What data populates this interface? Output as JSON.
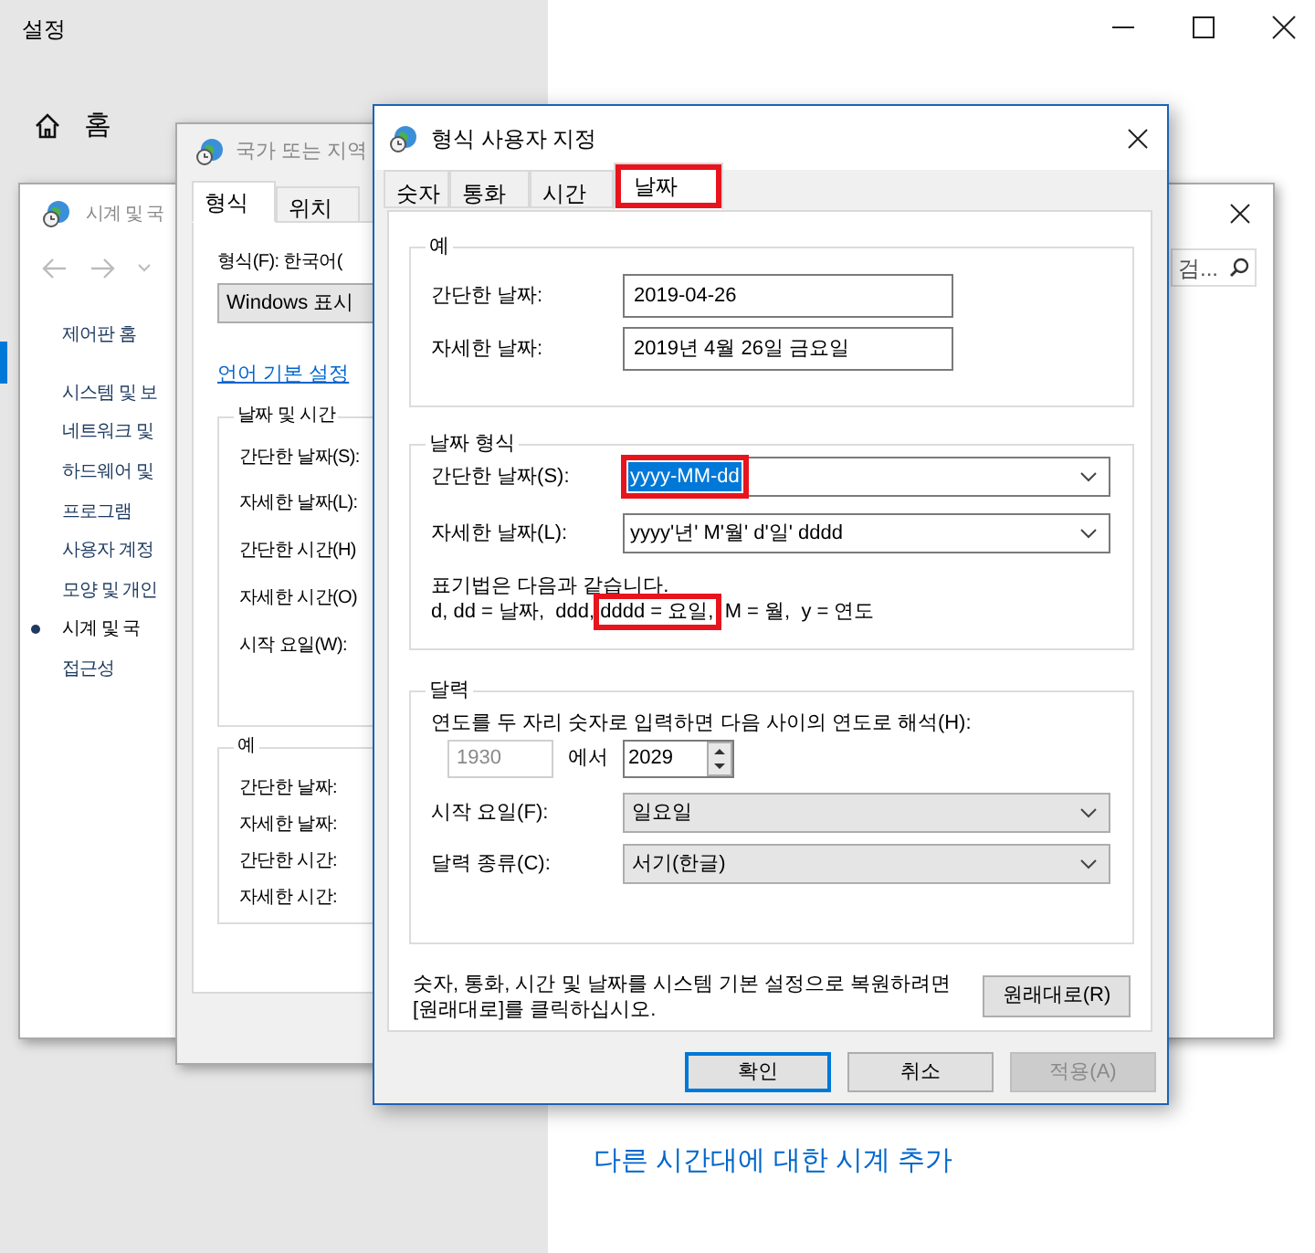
{
  "settings": {
    "title": "설정",
    "home": "홈",
    "link": "다른 시간대에 대한 시계 추가"
  },
  "control_panel": {
    "title": "시계 및 국",
    "search": {
      "placeholder": "검..."
    },
    "sidebar": [
      {
        "label": "제어판 홈",
        "selected": false
      },
      {
        "label": "시스템 및 보",
        "selected": false
      },
      {
        "label": "네트워크 및",
        "selected": false
      },
      {
        "label": "하드웨어 및",
        "selected": false
      },
      {
        "label": "프로그램",
        "selected": false
      },
      {
        "label": "사용자 계정",
        "selected": false
      },
      {
        "label": "모양 및 개인",
        "selected": false
      },
      {
        "label": "시계 및 국",
        "selected": true
      },
      {
        "label": "접근성",
        "selected": false
      }
    ]
  },
  "region_dialog": {
    "title": "국가 또는 지역",
    "tabs": [
      {
        "label": "형식",
        "selected": true
      },
      {
        "label": "위치",
        "selected": false
      }
    ],
    "format_label": "형식(F): 한국어(",
    "display_dropdown": "Windows 표시",
    "language_link": "언어 기본 설정",
    "formats_group": {
      "title": "날짜 및 시간",
      "labels": [
        "간단한 날짜(S):",
        "자세한 날짜(L):",
        "간단한 시간(H)",
        "자세한 시간(O)",
        "시작 요일(W):"
      ]
    },
    "examples_group": {
      "title": "예",
      "labels": [
        "간단한 날짜:",
        "자세한 날짜:",
        "간단한 시간:",
        "자세한 시간:"
      ]
    }
  },
  "custom_dialog": {
    "title": "형식 사용자 지정",
    "tabs": [
      {
        "label": "숫자",
        "selected": false,
        "highlighted": false
      },
      {
        "label": "통화",
        "selected": false,
        "highlighted": false
      },
      {
        "label": "시간",
        "selected": false,
        "highlighted": false
      },
      {
        "label": "날짜",
        "selected": true,
        "highlighted": true
      }
    ],
    "example_group": {
      "title": "예",
      "rows": [
        {
          "label": "간단한 날짜:",
          "value": "2019-04-26"
        },
        {
          "label": "자세한 날짜:",
          "value": "2019년 4월 26일 금요일"
        }
      ]
    },
    "date_format_group": {
      "title": "날짜 형식",
      "rows": [
        {
          "label": "간단한 날짜(S):",
          "value": "yyyy-MM-dd",
          "text_selected": true,
          "highlighted": true
        },
        {
          "label": "자세한 날짜(L):",
          "value": "yyyy'년' M'월' d'일' dddd",
          "text_selected": false,
          "highlighted": false
        }
      ],
      "notation_title": "표기법은 다음과 같습니다.",
      "notation": [
        {
          "text": "d, dd = 날짜,  ddd, ",
          "highlighted": false
        },
        {
          "text": "dddd = 요일,",
          "highlighted": true
        },
        {
          "text": "  M = 월,  y = 연도",
          "highlighted": false
        }
      ]
    },
    "calendar_group": {
      "title": "달력",
      "two_digit_label": "연도를 두 자리 숫자로 입력하면 다음 사이의 연도로 해석(H):",
      "year_from": "1930",
      "between": "에서",
      "year_to": "2029",
      "rows": [
        {
          "label": "시작 요일(F):",
          "value": "일요일"
        },
        {
          "label": "달력 종류(C):",
          "value": "서기(한글)"
        }
      ]
    },
    "restore_text": "숫자, 통화, 시간 및 날짜를 시스템 기본 설정으로 복원하려면 [원래대로]를 클릭하십시오.",
    "restore_button": "원래대로(R)",
    "buttons": [
      {
        "label": "확인",
        "kind": "default",
        "disabled": false
      },
      {
        "label": "취소",
        "kind": "normal",
        "disabled": false
      },
      {
        "label": "적용(A)",
        "kind": "normal",
        "disabled": true
      }
    ]
  }
}
